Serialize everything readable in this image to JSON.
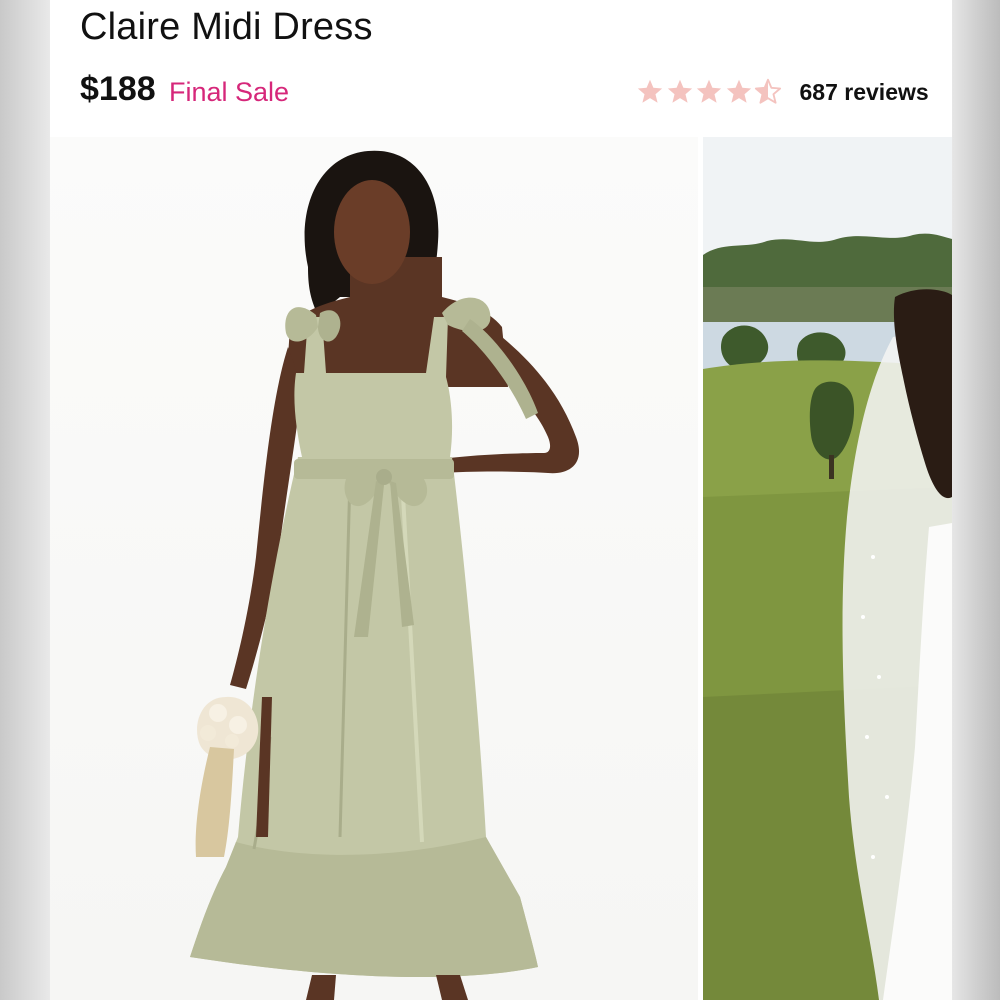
{
  "product": {
    "title": "Claire Midi Dress",
    "price": "$188",
    "sale_label": "Final Sale",
    "rating": 4.5,
    "rating_max": 5,
    "reviews_label": "687 reviews"
  },
  "colors": {
    "accent": "#d6277a",
    "star": "#f4c3bf",
    "dress": "#c3c7a6"
  },
  "gallery": {
    "images": [
      {
        "name": "model-front-photo"
      },
      {
        "name": "bride-field-photo"
      }
    ]
  }
}
